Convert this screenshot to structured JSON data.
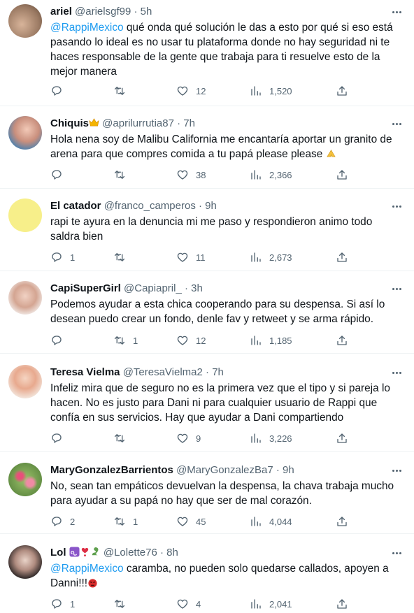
{
  "tweets": [
    {
      "name": "ariel",
      "handle": "@arielsgf99",
      "sep": "·",
      "time": "5h",
      "mention": "@RappiMexico",
      "text": " qué onda qué solución le das a esto por qué si eso está pasando lo ideal es no usar tu plataforma donde no hay seguridad ni te haces responsable de la gente que trabaja para ti resuelve esto de la mejor manera",
      "replies": "",
      "retweets": "",
      "likes": "12",
      "views": "1,520"
    },
    {
      "name": "Chiquis",
      "name_emoji": "crown",
      "handle": "@aprilurrutia87",
      "sep": "·",
      "time": "7h",
      "mention": "",
      "text": "Hola nena soy de Malibu California  me encantaría aportar un granito de arena para que compres comida a tu papá please please",
      "text_emoji": "folded-hands",
      "replies": "",
      "retweets": "",
      "likes": "38",
      "views": "2,366"
    },
    {
      "name": "El catador",
      "handle": "@franco_camperos",
      "sep": "·",
      "time": "9h",
      "mention": "",
      "text": "rapi te ayura en la denuncia mi me paso y respondieron  animo  todo saldra bien",
      "replies": "1",
      "retweets": "",
      "likes": "11",
      "views": "2,673"
    },
    {
      "name": "CapiSuperGirl",
      "handle": "@Capiapril_",
      "sep": "·",
      "time": "3h",
      "mention": "",
      "text": "Podemos ayudar a esta chica cooperando para su despensa. Si así lo desean puedo crear un fondo, denle fav y retweet y se arma rápido.",
      "replies": "",
      "retweets": "1",
      "likes": "12",
      "views": "1,185"
    },
    {
      "name": "Teresa Vielma",
      "handle": "@TeresaVielma2",
      "sep": "·",
      "time": "7h",
      "mention": "",
      "text": "Infeliz mira que de seguro no es la primera vez que el tipo y si pareja lo hacen. No es justo para Dani ni para cualquier usuario de Rappi que confía en sus servicios. Hay que ayudar a Dani compartiendo",
      "replies": "",
      "retweets": "",
      "likes": "9",
      "views": "3,226"
    },
    {
      "name": "MaryGonzalezBarrientos",
      "handle": "@MaryGonzalezBa7",
      "sep": "·",
      "time": "9h",
      "mention": "",
      "text": "No, sean tan empáticos devuelvan la despensa, la chava trabaja mucho para ayudar a su papá no hay que ser de mal corazón.",
      "replies": "2",
      "retweets": "1",
      "likes": "45",
      "views": "4,044"
    },
    {
      "name": "Lol",
      "name_emoji": "leo-heart-dragon",
      "handle": "@Lolette76",
      "sep": "·",
      "time": "8h",
      "mention": "@RappiMexico",
      "text": " caramba, no pueden solo quedarse callados, apoyen a Danni!!!",
      "text_emoji": "angry-face",
      "replies": "1",
      "retweets": "",
      "likes": "4",
      "views": "2,041"
    }
  ],
  "icons": [
    "reply-icon",
    "retweet-icon",
    "like-icon",
    "views-icon",
    "share-icon",
    "more-icon"
  ],
  "colors": {
    "accent": "#1d9bf0",
    "muted": "#536471",
    "text": "#0f1419",
    "divider": "#eff3f4"
  }
}
